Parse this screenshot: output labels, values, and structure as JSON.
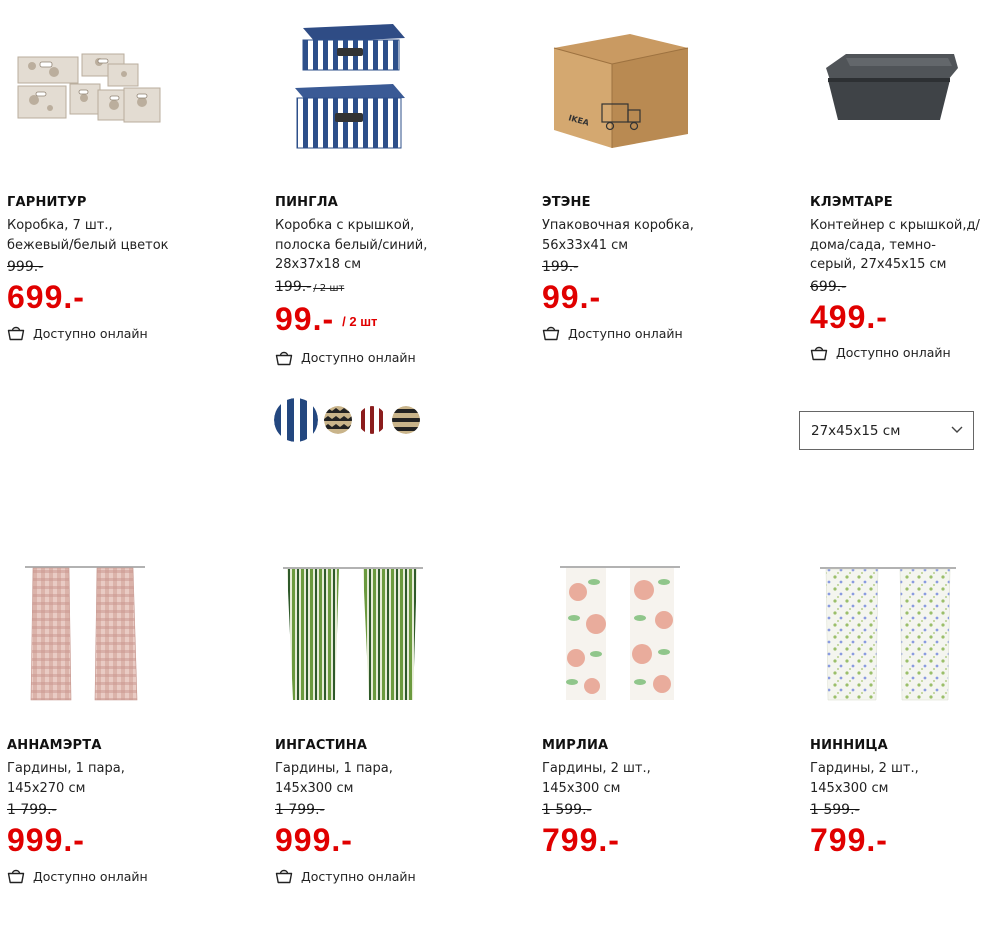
{
  "products": [
    {
      "name": "ГАРНИТУР",
      "desc": "Коробка, 7 шт., бежевый/белый цветок",
      "old_price": "999.-",
      "price": "699.-",
      "availability": "Доступно онлайн"
    },
    {
      "name": "ПИНГЛА",
      "desc": "Коробка с крышкой, полоска белый/синий, 28x37x18 см",
      "old_price": "199.-",
      "old_unit": "/ 2 шт",
      "price": "99.-",
      "price_unit": "/ 2 шт",
      "availability": "Доступно онлайн"
    },
    {
      "name": "ЭТЭНЕ",
      "desc": "Упаковочная коробка, 56x33x41 см",
      "old_price": "199.-",
      "price": "99.-",
      "availability": "Доступно онлайн"
    },
    {
      "name": "КЛЭМТАРЕ",
      "desc": "Контейнер с крышкой,д/дома/сада, темно-серый, 27x45x15 см",
      "old_price": "699.-",
      "price": "499.-",
      "availability": "Доступно онлайн"
    },
    {
      "name": "АННАМЭРТА",
      "desc": "Гардины, 1 пара, 145x270 см",
      "old_price": "1 799.-",
      "price": "999.-",
      "availability": "Доступно онлайн"
    },
    {
      "name": "ИНГАСТИНА",
      "desc": "Гардины, 1 пара, 145x300 см",
      "old_price": "1 799.-",
      "price": "999.-",
      "availability": "Доступно онлайн"
    },
    {
      "name": "МИРЛИА",
      "desc": "Гардины, 2 шт., 145x300 см",
      "old_price": "1 599.-",
      "price": "799.-"
    },
    {
      "name": "НИННИЦА",
      "desc": "Гардины, 2 шт., 145x300 см",
      "old_price": "1 599.-",
      "price": "799.-"
    }
  ],
  "size_select": {
    "value": "27x45x15 см"
  },
  "swatches": [
    "blue-white-stripe",
    "black-beige-zigzag",
    "red-white-stripe",
    "black-beige-stripe"
  ],
  "colors": {
    "price_red": "#e00000",
    "text": "#111111"
  }
}
